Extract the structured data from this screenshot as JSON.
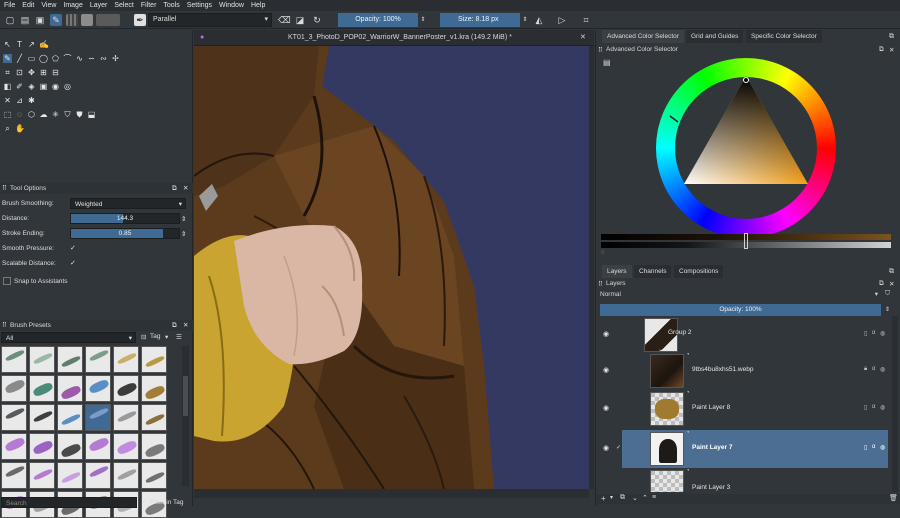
{
  "menubar": [
    "File",
    "Edit",
    "View",
    "Image",
    "Layer",
    "Select",
    "Filter",
    "Tools",
    "Settings",
    "Window",
    "Help"
  ],
  "toolbar": {
    "brush_name": "Parallel",
    "opacity_label": "Opacity: 100%",
    "size_label": "Size: 8.18 px"
  },
  "document": {
    "tab_title": "KT01_3_PhotoD_POP02_WarriorW_BannerPoster_v1.kra (149.2 MiB) *"
  },
  "tool_options": {
    "title": "Tool Options",
    "smoothing_label": "Brush Smoothing:",
    "smoothing_value": "Weighted",
    "distance_label": "Distance:",
    "distance_value": "144.3",
    "distance_fraction": 0.48,
    "stroke_label": "Stroke Ending:",
    "stroke_value": "0.85",
    "stroke_fraction": 0.85,
    "pressure_label": "Smooth Pressure:",
    "scalable_label": "Scalable Distance:",
    "snap_label": "Snap to Assistants"
  },
  "brush_presets": {
    "title": "Brush Presets",
    "filter_value": "All",
    "tag_label": "Tag",
    "search_placeholder": "Search",
    "filter_in_tag": "Filter in Tag"
  },
  "color_panel": {
    "tabs": [
      "Advanced Color Selector",
      "Grid and Guides",
      "Specific Color Selector"
    ],
    "title": "Advanced Color Selector"
  },
  "layers_panel": {
    "tabs": [
      "Layers",
      "Channels",
      "Compositions"
    ],
    "title": "Layers",
    "blend_mode": "Normal",
    "opacity_label": "Opacity:  100%",
    "layers": [
      {
        "name": "Group 2"
      },
      {
        "name": "9tbs4bu8xhs51.webp"
      },
      {
        "name": "Paint Layer 8"
      },
      {
        "name": "Paint Layer 7"
      },
      {
        "name": "Paint Layer 3"
      }
    ]
  },
  "colors": {
    "accent": "#3f6a94",
    "background": "#31363b",
    "canvas_bg": "#333960"
  }
}
